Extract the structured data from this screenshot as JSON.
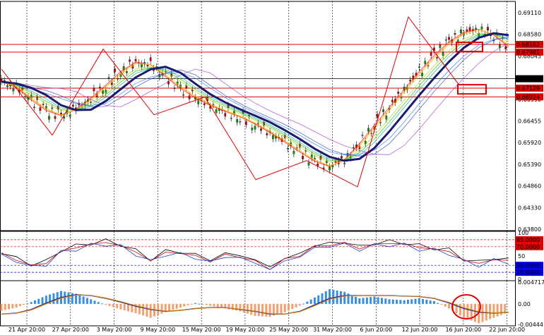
{
  "chart_data": [
    {
      "type": "line",
      "panel": "price",
      "ylim": [
        0.638,
        0.6911
      ],
      "yticks": [
        "0.69110",
        "0.68580",
        "0.68045",
        "0.67520",
        "0.66990",
        "0.66455",
        "0.65920",
        "0.65390",
        "0.64860",
        "0.64330",
        "0.63800"
      ],
      "levels": [
        {
          "label": "0.68162",
          "value": 0.68162,
          "color": "#e00000"
        },
        {
          "label": "0.67981",
          "value": 0.67981,
          "color": "#e00000"
        },
        {
          "label": "0.67352",
          "value": 0.67352,
          "color": "#000000"
        },
        {
          "label": "0.67129",
          "value": 0.67129,
          "color": "#e00000"
        },
        {
          "label": "0.66924",
          "value": 0.66924,
          "color": "#e00000"
        }
      ],
      "zigzag": [
        0.6758,
        0.6602,
        0.6805,
        0.665,
        0.6692,
        0.6497,
        0.6542,
        0.648,
        0.6881,
        0.672
      ],
      "series": [
        {
          "values": [
            0.6728,
            0.6715,
            0.6685,
            0.666,
            0.6648,
            0.6664,
            0.669,
            0.672,
            0.6752,
            0.6775,
            0.6768,
            0.674,
            0.6712,
            0.669,
            0.6672,
            0.6658,
            0.6645,
            0.6628,
            0.6608,
            0.6585,
            0.6562,
            0.654,
            0.6528,
            0.6545,
            0.6582,
            0.6625,
            0.6668,
            0.671,
            0.6752,
            0.679,
            0.6822,
            0.6845,
            0.6852,
            0.6838,
            0.681
          ]
        }
      ],
      "xticks": [
        "21 Apr 20:00",
        "27 Apr 20:00",
        "3 May 20:00",
        "9 May 20:00",
        "15 May 20:00",
        "19 May 20:00",
        "25 May 20:00",
        "31 May 20:00",
        "6 Jun 20:00",
        "12 Jun 20:00",
        "16 Jun 20:00",
        "22 Jun 20:00"
      ]
    },
    {
      "type": "line",
      "panel": "oscillator",
      "ylim": [
        0,
        100
      ],
      "yticks": [
        "100",
        "50",
        "0"
      ],
      "levels": [
        {
          "label": "85.0000",
          "value": 85,
          "color": "#e00000"
        },
        {
          "label": "70.0000",
          "value": 70,
          "color": "#e00000"
        },
        {
          "label": "30.0000",
          "value": 30,
          "color": "#0000e0"
        },
        {
          "label": "15.0000",
          "value": 15,
          "color": "#0000e0"
        }
      ],
      "series": [
        {
          "values": [
            55,
            48,
            30,
            40,
            62,
            72,
            78,
            82,
            76,
            60,
            45,
            58,
            62,
            50,
            45,
            52,
            55,
            38,
            30,
            42,
            58,
            70,
            80,
            78,
            72,
            76,
            82,
            78,
            72,
            68,
            62,
            45,
            35,
            48,
            40
          ]
        }
      ]
    },
    {
      "type": "bar",
      "panel": "macd",
      "ylim": [
        -0.0044413,
        0.0047177
      ],
      "yticks": [
        "0.0047177",
        "0.00",
        "-0.0044413"
      ],
      "values": [
        -0.0015,
        -0.0008,
        0.0004,
        0.0018,
        0.0028,
        0.0022,
        0.001,
        -0.0002,
        -0.0012,
        -0.002,
        -0.003,
        -0.0018,
        -0.0008,
        0.0002,
        -0.0004,
        -0.001,
        -0.0016,
        -0.0026,
        -0.0028,
        -0.0018,
        -0.0004,
        0.0014,
        0.0032,
        0.0026,
        0.0012,
        0.0016,
        0.001,
        0.0008,
        0.0012,
        0.0006,
        -0.001,
        -0.003,
        -0.0042,
        -0.003,
        -0.0018
      ],
      "series": [
        {
          "values": [
            -0.0022,
            -0.002,
            -0.0012,
            0.0002,
            0.0014,
            0.002,
            0.0018,
            0.0012,
            0.0004,
            -0.0005,
            -0.0012,
            -0.0016,
            -0.0014,
            -0.001,
            -0.0008,
            -0.0008,
            -0.0012,
            -0.0016,
            -0.0022,
            -0.0022,
            -0.0016,
            -0.0002,
            0.0012,
            0.0018,
            0.0018,
            0.0018,
            0.0018,
            0.0017,
            0.0016,
            0.0012,
            0.0002,
            -0.001,
            -0.0018,
            -0.002,
            -0.0018
          ]
        }
      ]
    }
  ]
}
